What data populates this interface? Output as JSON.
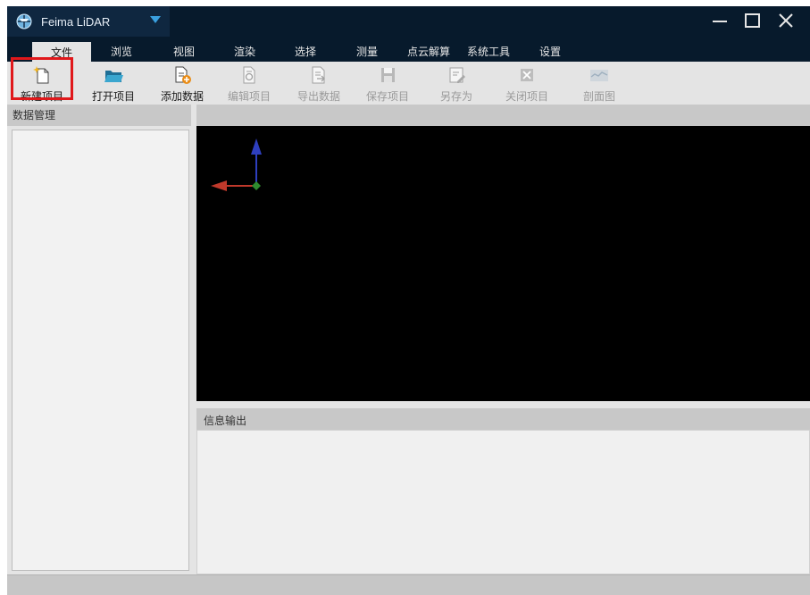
{
  "app": {
    "title": "Feima LiDAR",
    "brand_color": "#071a2c",
    "accent_color": "#3aa0e0"
  },
  "window_controls": {
    "minimize_icon": "minimize-icon",
    "maximize_icon": "maximize-icon",
    "close_icon": "close-icon"
  },
  "menu": {
    "items": [
      {
        "label": "文件",
        "active": true
      },
      {
        "label": "浏览"
      },
      {
        "label": "视图"
      },
      {
        "label": "渲染"
      },
      {
        "label": "选择"
      },
      {
        "label": "测量"
      },
      {
        "label": "点云解算"
      },
      {
        "label": "系统工具"
      },
      {
        "label": "设置"
      }
    ]
  },
  "toolbar": {
    "tools": [
      {
        "label": "新建项目",
        "icon": "new-project-icon",
        "enabled": true,
        "highlighted": true
      },
      {
        "label": "打开项目",
        "icon": "open-folder-icon",
        "enabled": true
      },
      {
        "label": "添加数据",
        "icon": "add-data-icon",
        "enabled": true
      },
      {
        "label": "编辑项目",
        "icon": "edit-project-icon",
        "enabled": false
      },
      {
        "label": "导出数据",
        "icon": "export-data-icon",
        "enabled": false
      },
      {
        "label": "保存项目",
        "icon": "save-icon",
        "enabled": false
      },
      {
        "label": "另存为",
        "icon": "save-as-icon",
        "enabled": false
      },
      {
        "label": "关闭项目",
        "icon": "close-project-icon",
        "enabled": false
      },
      {
        "label": "剖面图",
        "icon": "profile-chart-icon",
        "enabled": false
      }
    ],
    "highlight_color": "#e0181b"
  },
  "panels": {
    "data_management": {
      "title": "数据管理"
    },
    "info_output": {
      "title": "信息输出"
    }
  },
  "viewport": {
    "background": "#000000",
    "axis_colors": {
      "x": "#c0392b",
      "y": "#2e3fbf",
      "origin": "#2e8b2e"
    }
  }
}
